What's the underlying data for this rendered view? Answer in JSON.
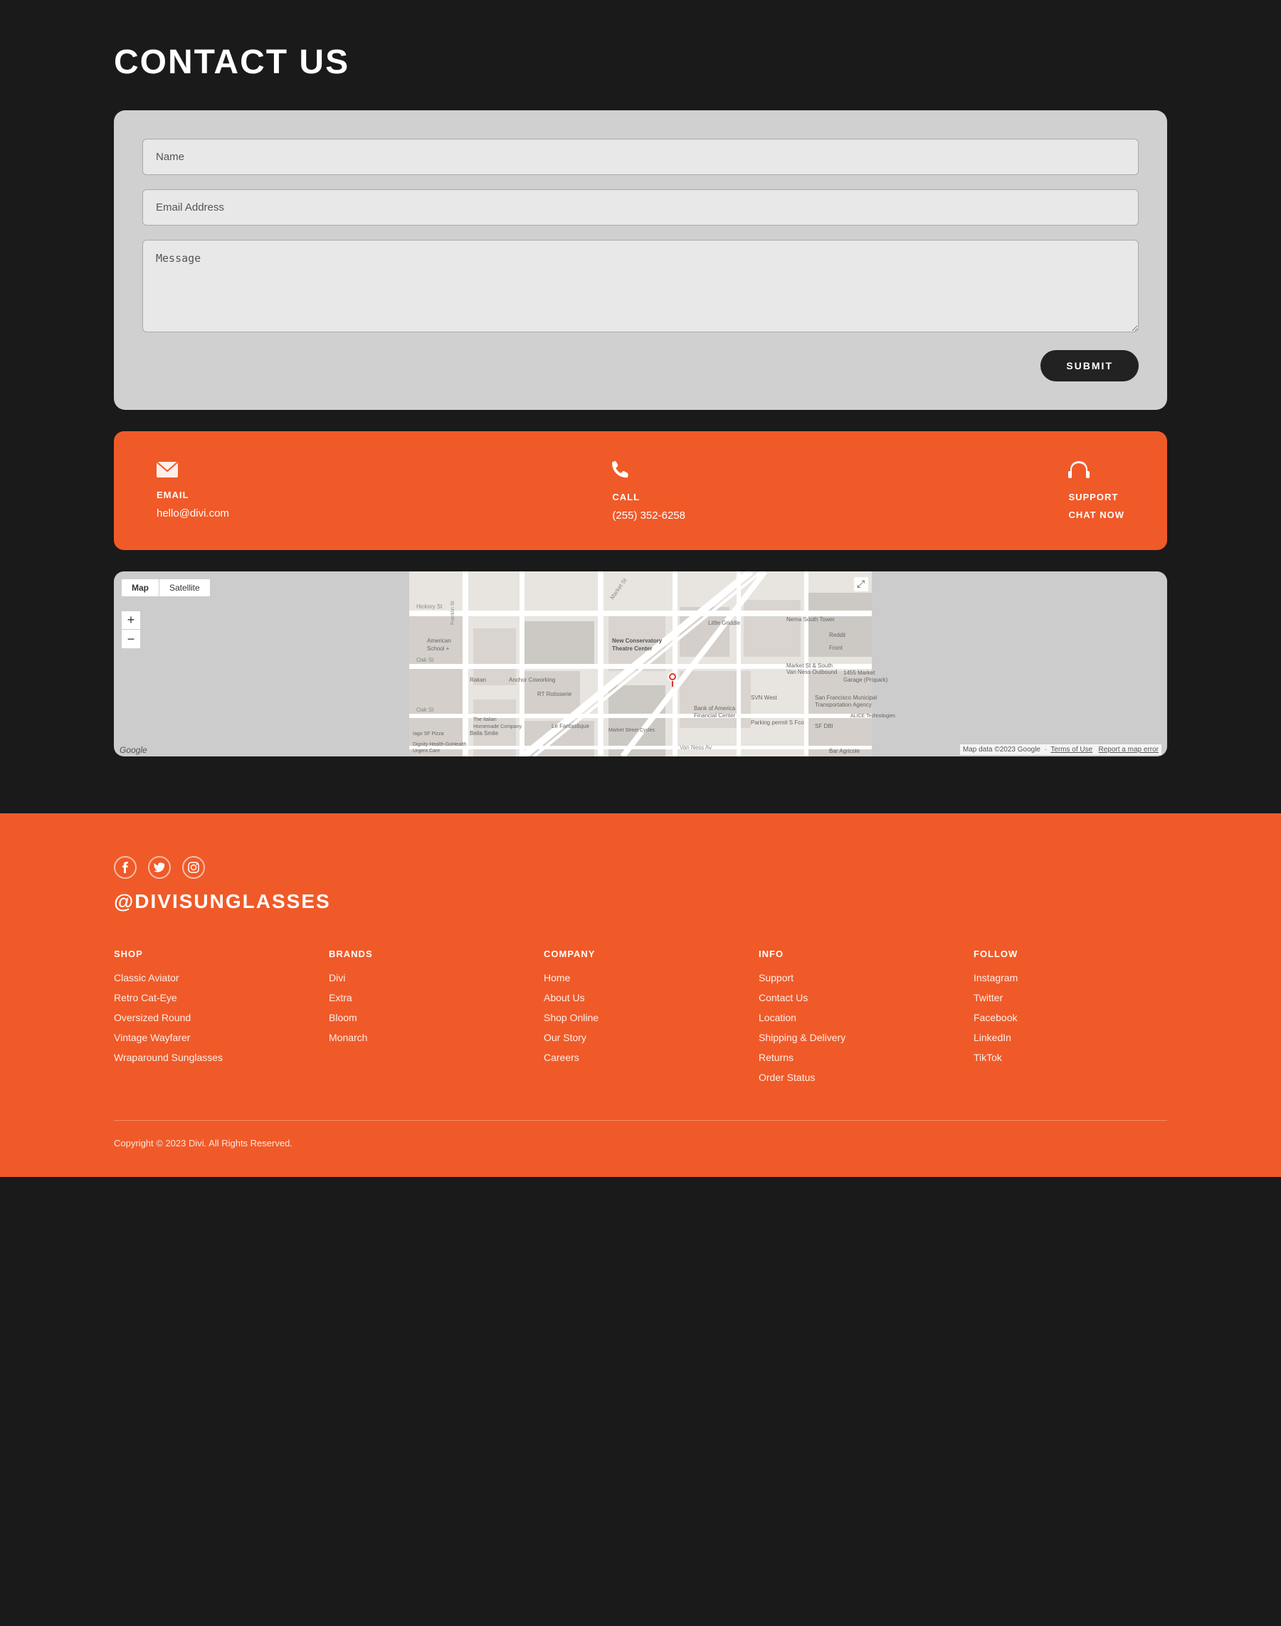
{
  "page": {
    "title": "Contact Us"
  },
  "contact_section": {
    "title": "CONTACT US",
    "form": {
      "name_placeholder": "Name",
      "email_placeholder": "Email Address",
      "message_placeholder": "Message",
      "submit_label": "SUBMIT"
    },
    "info_bar": {
      "email": {
        "icon": "✉",
        "label": "EMAIL",
        "value": "hello@divi.com"
      },
      "call": {
        "icon": "✆",
        "label": "CALL",
        "value": "(255) 352-6258"
      },
      "support": {
        "icon": "🎧",
        "label": "SUPPORT",
        "chat_label": "CHAT NOW"
      }
    },
    "map": {
      "tab_map": "Map",
      "tab_satellite": "Satellite",
      "attribution": "Map data ©2023 Google",
      "terms": "Terms of Use",
      "report": "Report a map error",
      "logo": "Google",
      "markers": [
        {
          "label": "American School"
        },
        {
          "label": "New Conservatory Theatre Center"
        }
      ]
    }
  },
  "footer": {
    "social": {
      "facebook_icon": "f",
      "twitter_icon": "t",
      "instagram_icon": "in"
    },
    "brand": "@DIVISUNGLASSES",
    "columns": {
      "shop": {
        "title": "SHOP",
        "items": [
          "Classic Aviator",
          "Retro Cat-Eye",
          "Oversized Round",
          "Vintage Wayfarer",
          "Wraparound Sunglasses"
        ]
      },
      "brands": {
        "title": "BRANDS",
        "items": [
          "Divi",
          "Extra",
          "Bloom",
          "Monarch"
        ]
      },
      "company": {
        "title": "COMPANY",
        "items": [
          "Home",
          "About Us",
          "Shop Online",
          "Our Story",
          "Careers"
        ]
      },
      "info": {
        "title": "INFO",
        "items": [
          "Support",
          "Contact Us",
          "Location",
          "Shipping & Delivery",
          "Returns",
          "Order Status"
        ]
      },
      "follow": {
        "title": "FOLLOW",
        "items": [
          "Instagram",
          "Twitter",
          "Facebook",
          "LinkedIn",
          "TikTok"
        ]
      }
    },
    "copyright": "Copyright © 2023 Divi. All Rights Reserved."
  }
}
